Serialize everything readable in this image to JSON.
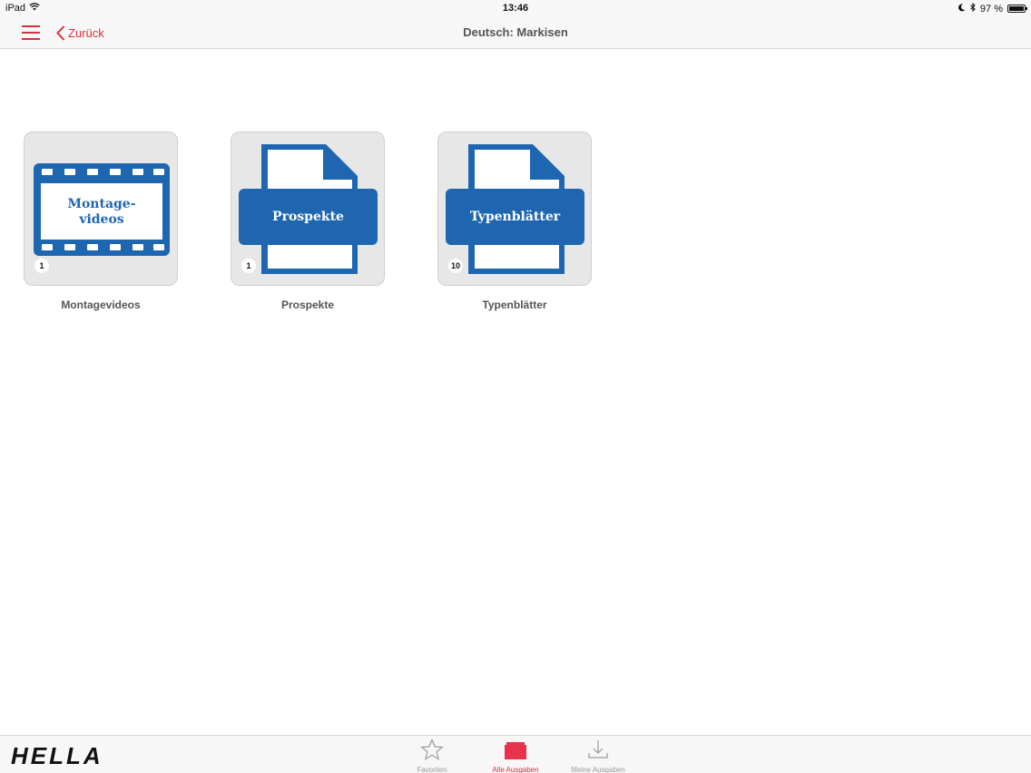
{
  "status_bar": {
    "device": "iPad",
    "time": "13:46",
    "battery_text": "97 %",
    "battery_level": 0.97
  },
  "nav": {
    "back_label": "Zurück",
    "title": "Deutsch: Markisen"
  },
  "tiles": [
    {
      "label": "Montagevideos",
      "icon_text": "Montage-\nvideos",
      "count": "1",
      "icon": "film-strip-icon"
    },
    {
      "label": "Prospekte",
      "icon_text": "Prospekte",
      "count": "1",
      "icon": "document-icon"
    },
    {
      "label": "Typenblätter",
      "icon_text": "Typenblätter",
      "count": "10",
      "icon": "document-icon"
    }
  ],
  "tab_bar": {
    "logo_text": "HELLA",
    "tabs": [
      {
        "label": "Favoriten",
        "icon": "star-icon",
        "active": false
      },
      {
        "label": "Alle Ausgaben",
        "icon": "folder-icon",
        "active": true
      },
      {
        "label": "Meine Ausgaben",
        "icon": "download-icon",
        "active": false
      }
    ]
  },
  "colors": {
    "accent": "#d9303e",
    "brand_blue": "#1f66b1",
    "tile_bg": "#e7e7e7"
  }
}
